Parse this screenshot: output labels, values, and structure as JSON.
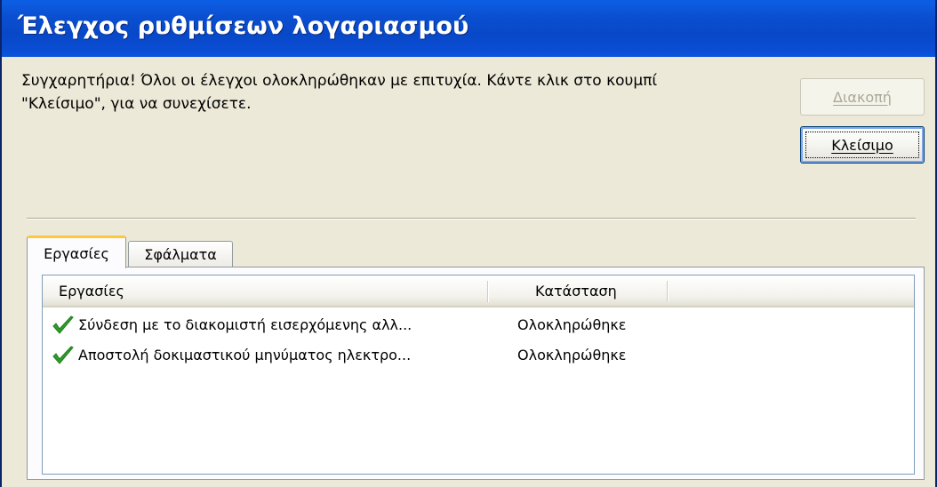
{
  "window": {
    "title": "Έλεγχος ρυθμίσεων λογαριασμού"
  },
  "message": {
    "line1": "Συγχαρητήρια! Όλοι οι έλεγχοι ολοκληρώθηκαν με επιτυχία. Κάντε κλικ στο κουμπί",
    "line2": "\"Κλείσιμο\", για να συνεχίσετε."
  },
  "buttons": {
    "stop": {
      "label": "Διακοπή",
      "enabled": false
    },
    "close": {
      "label": "Κλείσιμο",
      "enabled": true
    }
  },
  "tabs": [
    {
      "label": "Εργασίες",
      "active": true
    },
    {
      "label": "Σφάλματα",
      "active": false
    }
  ],
  "table": {
    "columns": [
      "Εργασίες",
      "Κατάσταση"
    ],
    "rows": [
      {
        "icon": "checkmark-icon",
        "task": "Σύνδεση με το διακομιστή εισερχόμενης αλλ...",
        "status": "Ολοκληρώθηκε"
      },
      {
        "icon": "checkmark-icon",
        "task": "Αποστολή δοκιμαστικού μηνύματος ηλεκτρο...",
        "status": "Ολοκληρώθηκε"
      }
    ]
  },
  "colors": {
    "titlebar": "#0a4fd0",
    "face": "#ece9d8",
    "check": "#2f9e2a",
    "active_tab_accent": "#ffc83c"
  }
}
